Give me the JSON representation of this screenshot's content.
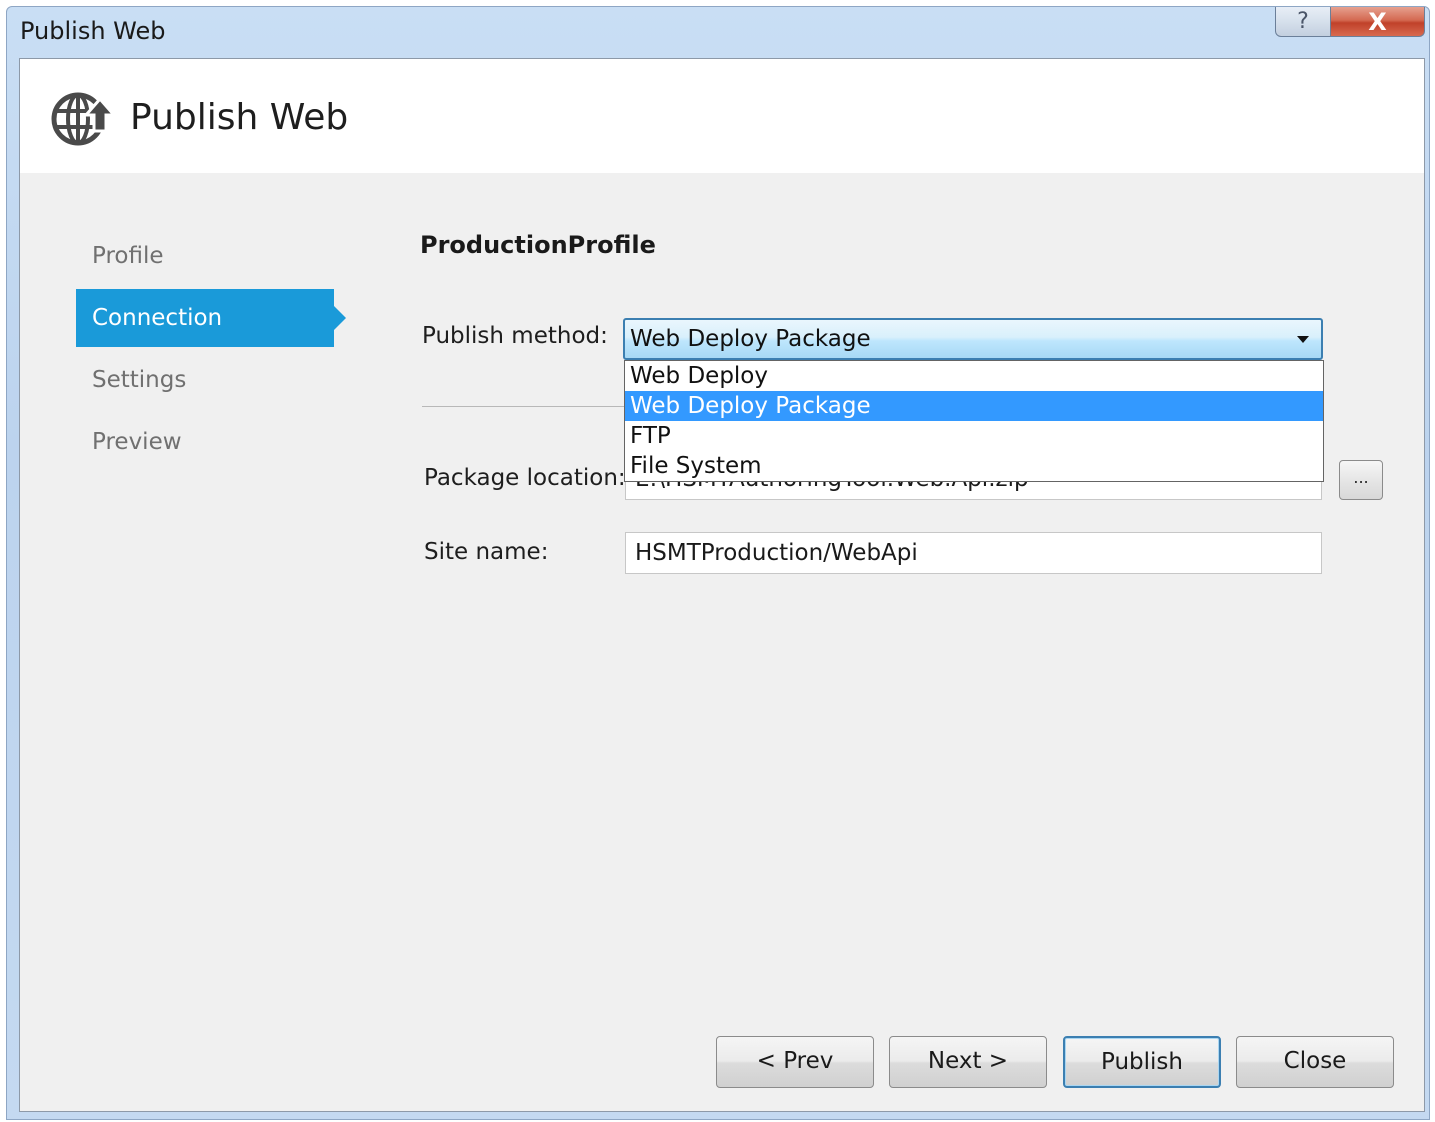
{
  "window": {
    "title": "Publish Web",
    "help_glyph": "?",
    "close_glyph": "X"
  },
  "header": {
    "title": "Publish Web",
    "icon": "globe-upload-icon"
  },
  "nav": {
    "items": [
      {
        "label": "Profile",
        "active": false
      },
      {
        "label": "Connection",
        "active": true
      },
      {
        "label": "Settings",
        "active": false
      },
      {
        "label": "Preview",
        "active": false
      }
    ]
  },
  "main": {
    "profile_name": "ProductionProfile",
    "publish_method": {
      "label": "Publish method:",
      "value": "Web Deploy Package",
      "options": [
        {
          "label": "Web Deploy",
          "selected": false
        },
        {
          "label": "Web Deploy Package",
          "selected": true
        },
        {
          "label": "FTP",
          "selected": false
        },
        {
          "label": "File System",
          "selected": false
        }
      ]
    },
    "package_location": {
      "label": "Package location:",
      "value": "E:\\HSMTAuthoringTool.Web.Api.zip",
      "browse_label": "..."
    },
    "site_name": {
      "label": "Site name:",
      "value": "HSMTProduction/WebApi"
    }
  },
  "footer": {
    "prev_label": "< Prev",
    "next_label": "Next >",
    "publish_label": "Publish",
    "close_label": "Close"
  },
  "colors": {
    "accent": "#1a9ad9",
    "selection": "#3399ff"
  }
}
